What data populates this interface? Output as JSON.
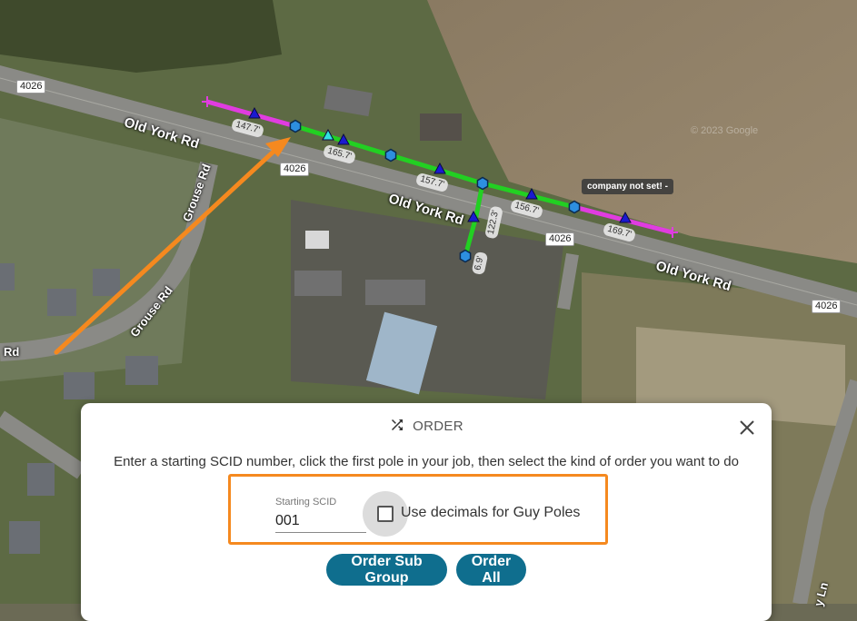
{
  "map": {
    "road_labels": {
      "old_york_1": "Old York Rd",
      "old_york_2": "Old York Rd",
      "old_york_3": "Old York Rd",
      "grouse_1": "Grouse Rd",
      "grouse_2": "Grouse Rd",
      "rd_left": "Rd",
      "ln_right": "y Ln"
    },
    "route_shields": {
      "s1": "4026",
      "s2": "4026",
      "s3": "4026",
      "s4": "4026"
    },
    "span_lengths": {
      "a": "147.7'",
      "b": "165.7'",
      "c": "157.7'",
      "d": "156.7'",
      "e": "169.7'",
      "f": "122.3'",
      "g": "6.9'"
    },
    "company_tooltip": "company not set! -",
    "watermark": "© 2023 Google",
    "colors": {
      "primary_span": "#22d022",
      "unassigned_span": "#e03ce0",
      "pole_hex": "#2d8fe0",
      "anchor_triangle": "#1a1ad0",
      "guy_triangle": "#33e0e0",
      "arrow": "#f5891f"
    }
  },
  "dialog": {
    "title": "ORDER",
    "title_icon": "shuffle-icon",
    "instructions": "Enter a starting SCID number, click the first pole in your job, then select the kind of order you want to do",
    "scid_label": "Starting SCID",
    "scid_value": "001",
    "checkbox_label": "Use decimals for Guy Poles",
    "checkbox_checked": false,
    "buttons": {
      "order_sub_group": "Order Sub Group",
      "order_all": "Order All"
    }
  }
}
